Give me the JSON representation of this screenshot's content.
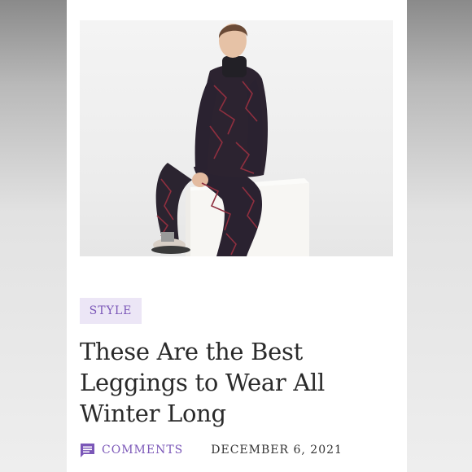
{
  "article": {
    "category": "STYLE",
    "title": "These Are the Best Leggings to Wear All Winter Long",
    "comments_label": "COMMENTS",
    "date": "DECEMBER 6, 2021"
  },
  "icons": {
    "comments": "comment-icon"
  },
  "colors": {
    "accent": "#7b57b8",
    "tag_background": "#ece6f6",
    "headline": "#2a2a2a"
  }
}
